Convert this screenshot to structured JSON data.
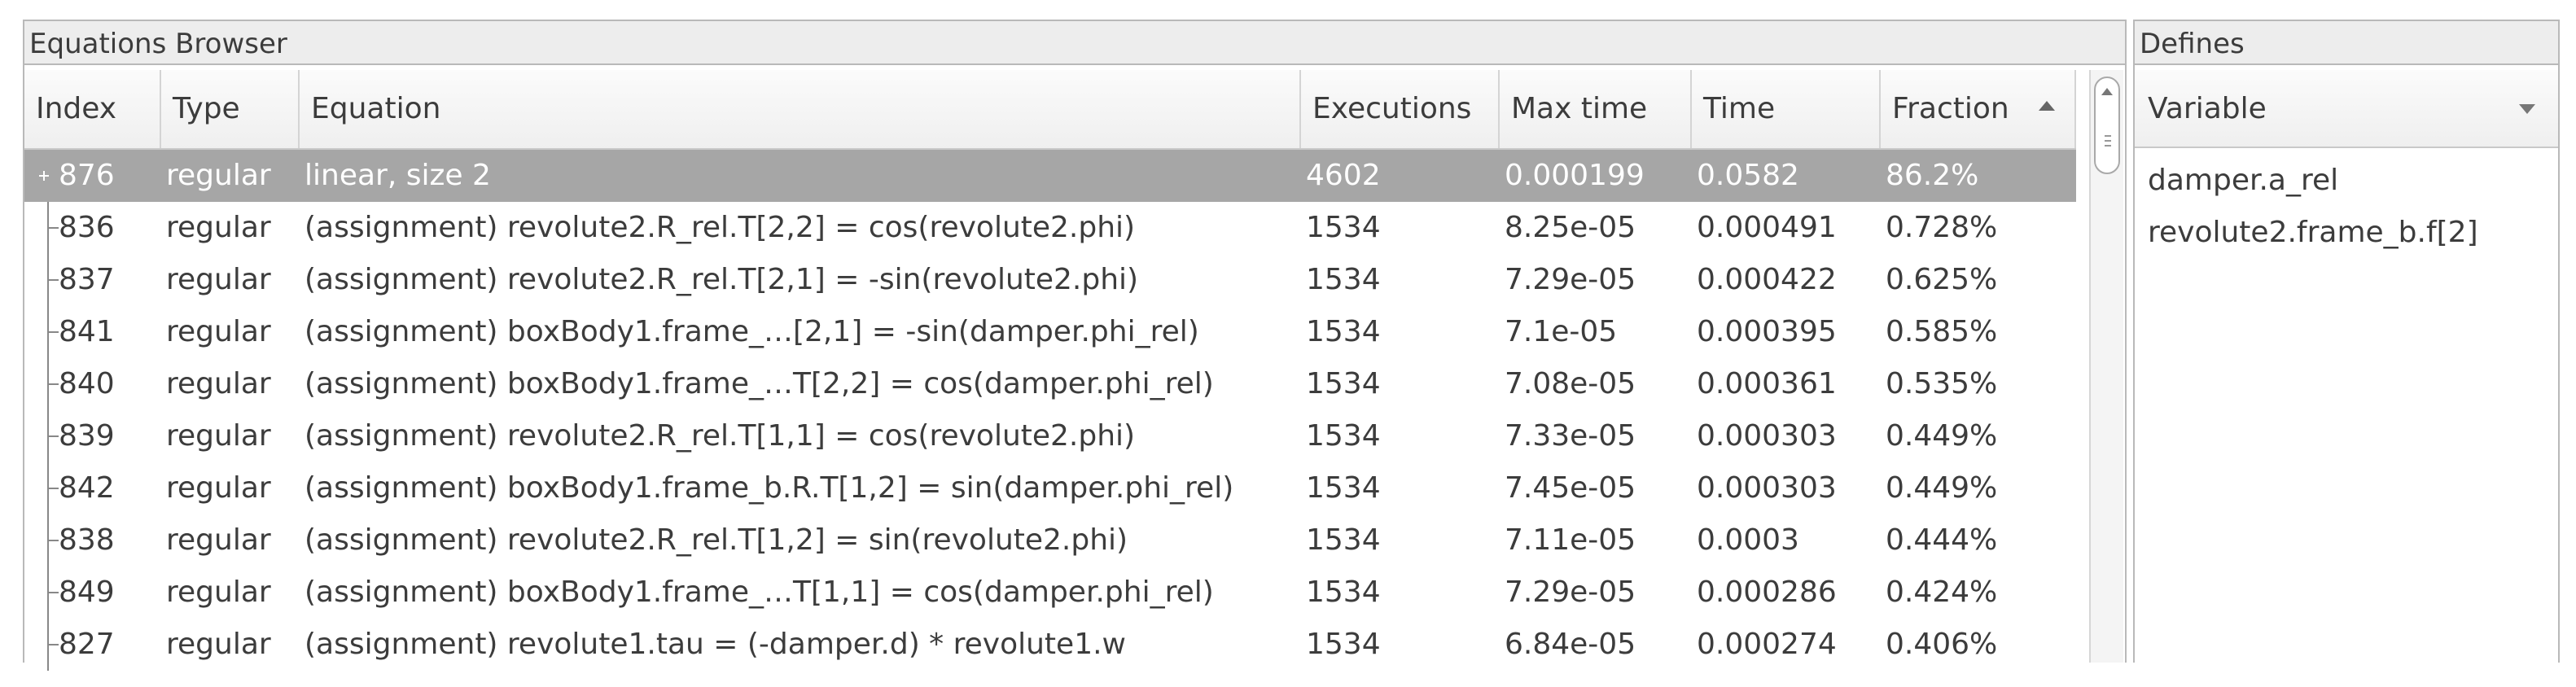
{
  "equations_browser": {
    "title": "Equations Browser",
    "columns": [
      "Index",
      "Type",
      "Equation",
      "Executions",
      "Max time",
      "Time",
      "Fraction"
    ],
    "sort_column": "Fraction",
    "sort_direction": "ascending",
    "rows": [
      {
        "index": "876",
        "type": "regular",
        "equation": "linear, size 2",
        "executions": "4602",
        "max_time": "0.000199",
        "time": "0.0582",
        "fraction": "86.2%",
        "selected": true,
        "expandable": true
      },
      {
        "index": "836",
        "type": "regular",
        "equation": "(assignment) revolute2.R_rel.T[2,2] = cos(revolute2.phi)",
        "executions": "1534",
        "max_time": "8.25e-05",
        "time": "0.000491",
        "fraction": "0.728%"
      },
      {
        "index": "837",
        "type": "regular",
        "equation": "(assignment) revolute2.R_rel.T[2,1] = -sin(revolute2.phi)",
        "executions": "1534",
        "max_time": "7.29e-05",
        "time": "0.000422",
        "fraction": "0.625%"
      },
      {
        "index": "841",
        "type": "regular",
        "equation": "(assignment) boxBody1.frame_…[2,1] = -sin(damper.phi_rel)",
        "executions": "1534",
        "max_time": "7.1e-05",
        "time": "0.000395",
        "fraction": "0.585%"
      },
      {
        "index": "840",
        "type": "regular",
        "equation": "(assignment) boxBody1.frame_…T[2,2] = cos(damper.phi_rel)",
        "executions": "1534",
        "max_time": "7.08e-05",
        "time": "0.000361",
        "fraction": "0.535%"
      },
      {
        "index": "839",
        "type": "regular",
        "equation": "(assignment) revolute2.R_rel.T[1,1] = cos(revolute2.phi)",
        "executions": "1534",
        "max_time": "7.33e-05",
        "time": "0.000303",
        "fraction": "0.449%"
      },
      {
        "index": "842",
        "type": "regular",
        "equation": "(assignment) boxBody1.frame_b.R.T[1,2] = sin(damper.phi_rel)",
        "executions": "1534",
        "max_time": "7.45e-05",
        "time": "0.000303",
        "fraction": "0.449%"
      },
      {
        "index": "838",
        "type": "regular",
        "equation": "(assignment) revolute2.R_rel.T[1,2] = sin(revolute2.phi)",
        "executions": "1534",
        "max_time": "7.11e-05",
        "time": "0.0003",
        "fraction": "0.444%"
      },
      {
        "index": "849",
        "type": "regular",
        "equation": "(assignment) boxBody1.frame_…T[1,1] = cos(damper.phi_rel)",
        "executions": "1534",
        "max_time": "7.29e-05",
        "time": "0.000286",
        "fraction": "0.424%"
      },
      {
        "index": "827",
        "type": "regular",
        "equation": "(assignment) revolute1.tau = (-damper.d) * revolute1.w",
        "executions": "1534",
        "max_time": "6.84e-05",
        "time": "0.000274",
        "fraction": "0.406%"
      }
    ]
  },
  "defines": {
    "title": "Defines",
    "column": "Variable",
    "items": [
      "damper.a_rel",
      "revolute2.frame_b.f[2]"
    ]
  },
  "colors": {
    "selected_row": "#a6a6a6",
    "header_bg": "#efefef",
    "border": "#b9b9b9"
  },
  "icons": [
    "expand-plus-icon",
    "sort-ascending-icon",
    "sort-descending-icon",
    "scroll-up-icon"
  ]
}
